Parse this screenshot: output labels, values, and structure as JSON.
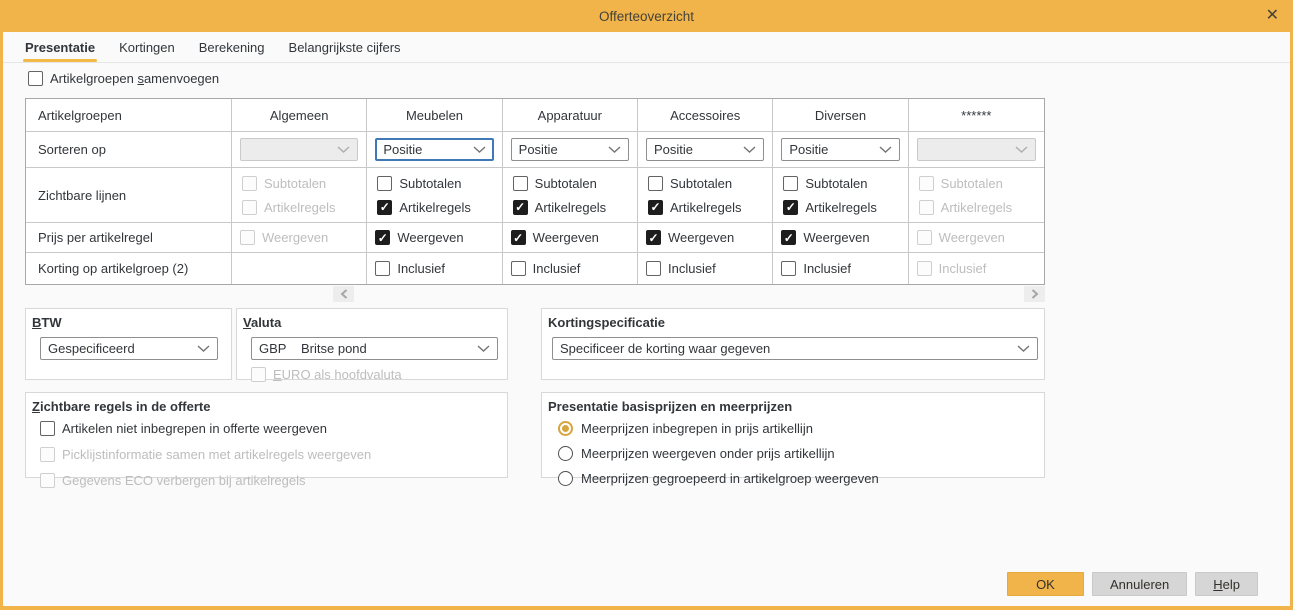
{
  "window": {
    "title": "Offerteoverzicht",
    "close_icon": "✕"
  },
  "tabs": [
    {
      "label": "Presentatie",
      "active": true
    },
    {
      "label": "Kortingen",
      "active": false
    },
    {
      "label": "Berekening",
      "active": false
    },
    {
      "label": "Belangrijkste cijfers",
      "active": false
    }
  ],
  "merge_checkbox": {
    "label_html": "Artikelgroepen <u>s</u>amenvoegen",
    "checked": false
  },
  "table": {
    "headers": [
      "Artikelgroepen",
      "Algemeen",
      "Meubelen",
      "Apparatuur",
      "Accessoires",
      "Diversen",
      "******"
    ],
    "row_labels": {
      "sort": "Sorteren op",
      "visible_lines": "Zichtbare lijnen",
      "price_per_line": "Prijs per artikelregel",
      "group_discount": "Korting op artikelgroep (2)"
    },
    "option_labels": {
      "subtotals": "Subtotalen",
      "article_lines": "Artikelregels",
      "show": "Weergeven",
      "inclusive": "Inclusief"
    },
    "sort_values": {
      "algemeen": "",
      "meubelen": "Positie",
      "apparatuur": "Positie",
      "accessoires": "Positie",
      "diversen": "Positie",
      "masked": ""
    },
    "column_states": {
      "algemeen": {
        "enabled": false,
        "subtotals": false,
        "article_lines": false,
        "show": false,
        "inclusive": null
      },
      "meubelen": {
        "enabled": true,
        "sort_focused": true,
        "subtotals": false,
        "article_lines": true,
        "show": true,
        "inclusive": false
      },
      "apparatuur": {
        "enabled": true,
        "subtotals": false,
        "article_lines": true,
        "show": true,
        "inclusive": false
      },
      "accessoires": {
        "enabled": true,
        "subtotals": false,
        "article_lines": true,
        "show": true,
        "inclusive": false
      },
      "diversen": {
        "enabled": true,
        "subtotals": false,
        "article_lines": true,
        "show": true,
        "inclusive": false
      },
      "masked": {
        "enabled": false,
        "subtotals": false,
        "article_lines": false,
        "show": false,
        "inclusive": false
      }
    }
  },
  "scroll": {
    "left_icon": "‹",
    "right_icon": "›"
  },
  "btw": {
    "label_html": "<u>B</u>TW",
    "value": "Gespecificeerd"
  },
  "valuta": {
    "label_html": "<u>V</u>aluta",
    "code": "GBP",
    "name": "Britse pond",
    "euro_checkbox_html": "<u>E</u>URO als hoofdvaluta",
    "euro_checked": false,
    "euro_enabled": false
  },
  "kortingspecificatie": {
    "label": "Kortingspecificatie",
    "value": "Specificeer de korting waar gegeven"
  },
  "visible_rows": {
    "label_html": "<u>Z</u>ichtbare regels in de offerte",
    "options": [
      {
        "label": "Artikelen niet inbegrepen in offerte weergeven",
        "checked": false,
        "enabled": true
      },
      {
        "label": "Picklijstinformatie samen met artikelregels weergeven",
        "checked": false,
        "enabled": false
      },
      {
        "label": "Gegevens ECO verbergen bij artikelregels",
        "checked": false,
        "enabled": false
      }
    ]
  },
  "presentation_prices": {
    "label": "Presentatie basisprijzen en meerprijzen",
    "options": [
      {
        "label": "Meerprijzen inbegrepen in prijs artikellijn",
        "selected": true
      },
      {
        "label": "Meerprijzen weergeven onder prijs artikellijn",
        "selected": false
      },
      {
        "label": "Meerprijzen gegroepeerd in artikelgroep weergeven",
        "selected": false
      }
    ]
  },
  "footer": {
    "ok": "OK",
    "cancel": "Annuleren",
    "help_html": "<u>H</u>elp"
  }
}
